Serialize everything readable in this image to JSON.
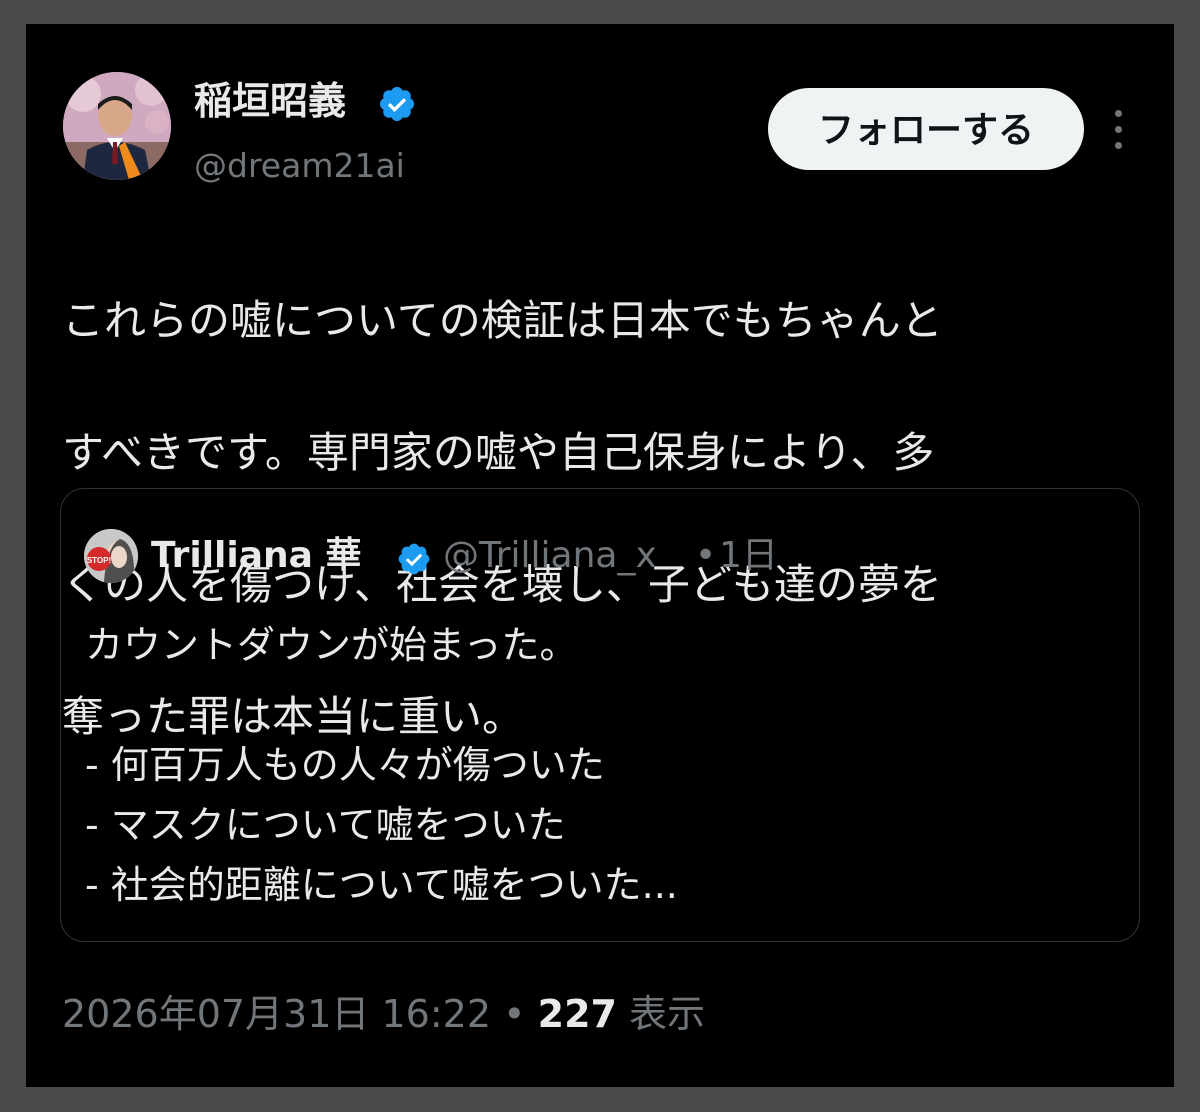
{
  "colors": {
    "background": "#000000",
    "text_primary": "#e7e9ea",
    "text_secondary": "#71767b",
    "verified_badge": "#1d9bf0",
    "follow_button_bg": "#eff3f4",
    "border": "#2f3336"
  },
  "tweet": {
    "author_name": "稲垣昭義",
    "author_handle": "@dream21ai",
    "follow_label": "フォローする",
    "body_lines": [
      "これらの嘘についての検証は日本でもちゃんと",
      "すべきです。専門家の嘘や自己保身により、多",
      "くの人を傷つけ、社会を壊し、子ども達の夢を",
      "奪った罪は本当に重い。"
    ],
    "timestamp": "2026年07月31日 16:22",
    "separator": "•",
    "view_count": "227",
    "view_label": "表示"
  },
  "quote": {
    "author_name": "Trilliana 華",
    "author_handle": "@Trilliana_x",
    "separator": "•",
    "time_ago": "1日",
    "avatar_sign_text": "STOP!",
    "lines": [
      "カウントダウンが始まった。",
      "",
      "- 何百万人もの人々が傷ついた",
      "- マスクについて嘘をついた",
      "- 社会的距離について嘘をついた..."
    ]
  },
  "icons": {
    "verified": "verified-badge-icon",
    "more": "more-vertical-icon"
  }
}
